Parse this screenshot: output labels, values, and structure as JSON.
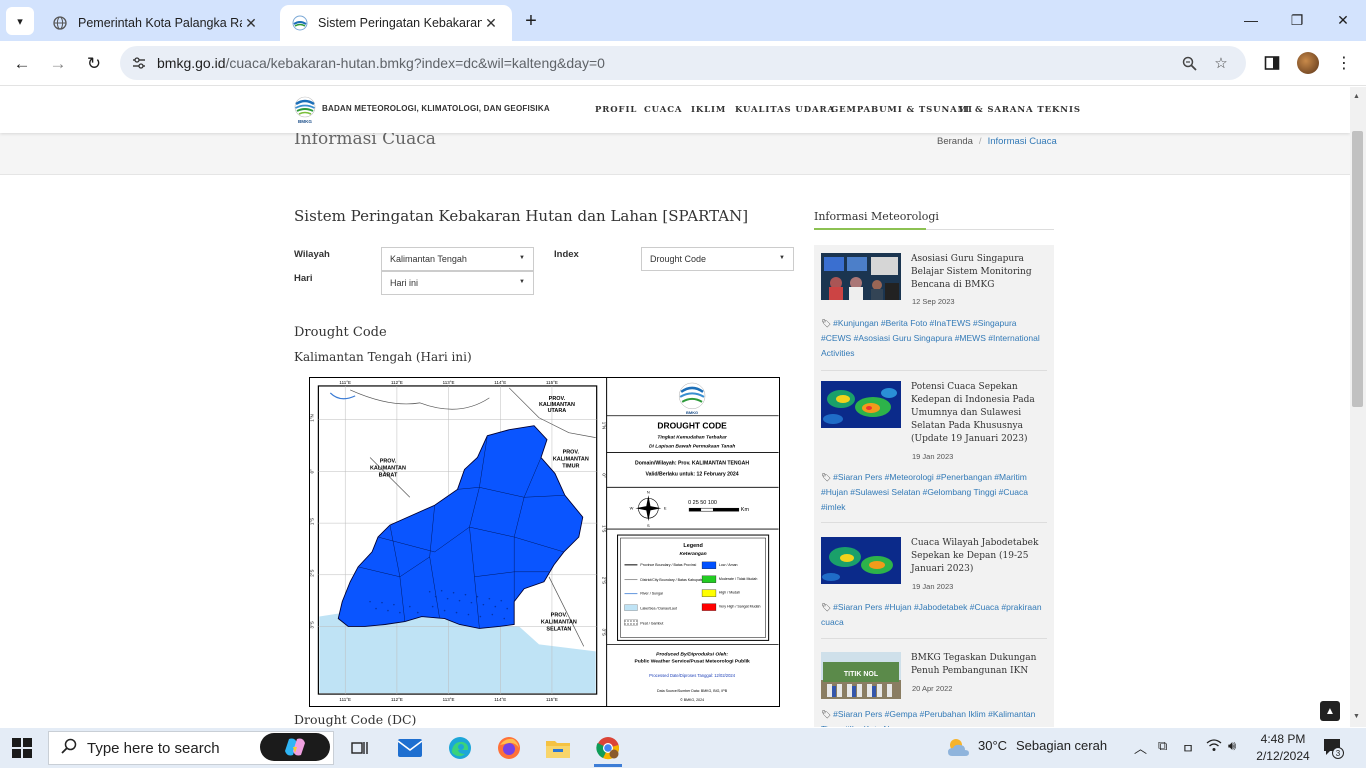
{
  "browser": {
    "tabs": [
      {
        "title": "Pemerintah Kota Palangka Raya",
        "active": false
      },
      {
        "title": "Sistem Peringatan Kebakaran H",
        "active": true
      }
    ],
    "url_host": "bmkg.go.id",
    "url_rest": "/cuaca/kebakaran-hutan.bmkg?index=dc&wil=kalteng&day=0",
    "icons": {
      "tab_dropdown": "chevron-down-icon",
      "new_tab": "plus-icon",
      "minimize": "minimize-icon",
      "restore": "restore-icon",
      "close": "close-icon",
      "back": "arrow-left-icon",
      "forward": "arrow-right-icon",
      "reload": "reload-icon",
      "site_info": "tune-icon",
      "zoom": "zoom-icon",
      "bookmark": "star-icon",
      "side_panel": "side-panel-icon",
      "menu": "kebab-menu-icon"
    }
  },
  "site": {
    "org_name": "BADAN METEOROLOGI, KLIMATOLOGI, DAN GEOFISIKA",
    "logo_text": "BMKG",
    "nav": [
      "PROFIL",
      "CUACA",
      "IKLIM",
      "KUALITAS UDARA",
      "GEMPABUMI & TSUNAMI",
      "IT & SARANA TEKNIS"
    ],
    "page_title": "Informasi Cuaca",
    "breadcrumb": {
      "home": "Beranda",
      "separator": "/",
      "current": "Informasi Cuaca"
    }
  },
  "main": {
    "section_title": "Sistem Peringatan Kebakaran Hutan dan Lahan [SPARTAN]",
    "form": {
      "wilayah_label": "Wilayah",
      "wilayah_value": "Kalimantan Tengah",
      "hari_label": "Hari",
      "hari_value": "Hari ini",
      "index_label": "Index",
      "index_value": "Drought Code"
    },
    "heading": "Drought Code",
    "subheading": "Kalimantan Tengah (Hari ini)",
    "map": {
      "title": "DROUGHT CODE",
      "subtitle1": "Tingkat Kemudahan Terbakar",
      "subtitle2": "Di Lapisan Bawah Permukaan Tanah",
      "domain": "Domain/Wilayah: Prov. KALIMANTAN TENGAH",
      "valid": "Valid/Berlaku untuk: 12 February 2024",
      "scale_text": "0  25 50     100",
      "scale_unit": "Km",
      "legend_title": "Legend",
      "legend_subtitle": "Keterangan",
      "legend_left": [
        "Province Boundary / Batas Provinsi",
        "District/City Boundary / Batas Kabupaten/Kota",
        "River / Sungai",
        "Lake/Sea / Danau/Laut",
        "Peat / Gambut"
      ],
      "legend_right": [
        {
          "label": "Low / Aman",
          "color": "#0050ff"
        },
        {
          "label": "Moderate / Tidak Mudah",
          "color": "#22cc22"
        },
        {
          "label": "High / Mudah",
          "color": "#ffff00"
        },
        {
          "label": "Very High / Sangat Mudah",
          "color": "#ff0000"
        }
      ],
      "produced_by": "Produced By/Diproduksi Oleh:",
      "producer": "Public Weather Service/Pusat Meteorologi Publik",
      "processed": "Processed Date/Diproses Tanggal: 12/02/2024",
      "datasource": "Data Source/Sumber Data: BMKG, BIG, IPB",
      "copyright": "© BMKG, 2024",
      "lon_labels": [
        "111°E",
        "112°E",
        "113°E",
        "114°E",
        "115°E"
      ],
      "lat_labels": [
        "1°N",
        "0°",
        "1°S",
        "2°S",
        "3°S"
      ],
      "province_labels": [
        "PROV. KALIMANTAN BARAT",
        "PROV. KALIMANTAN TIMUR",
        "PROV. KALIMANTAN SELATAN",
        "PROV. KALIMANTAN UTARA"
      ]
    },
    "caption": "Drought Code (DC)"
  },
  "sidebar": {
    "title": "Informasi Meteorologi",
    "items": [
      {
        "title": "Asosiasi Guru Singapura Belajar Sistem Monitoring Bencana di BMKG",
        "date": "12 Sep 2023",
        "tags": "#Kunjungan #Berita Foto #InaTEWS #Singapura #CEWS #Asosiasi Guru Singapura #MEWS #International Activities"
      },
      {
        "title": "Potensi Cuaca Sepekan Kedepan di Indonesia Pada Umumnya dan Sulawesi Selatan Pada Khususnya (Update 19 Januari 2023)",
        "date": "19 Jan 2023",
        "tags": "#Siaran Pers #Meteorologi #Penerbangan #Maritim #Hujan #Sulawesi Selatan #Gelombang Tinggi #Cuaca #imlek"
      },
      {
        "title": "Cuaca Wilayah Jabodetabek Sepekan ke Depan (19-25 Januari 2023)",
        "date": "19 Jan 2023",
        "tags": "#Siaran Pers #Hujan #Jabodetabek #Cuaca #prakiraan cuaca"
      },
      {
        "title": "BMKG Tegaskan Dukungan Penuh Pembangunan IKN",
        "date": "20 Apr 2022",
        "tags": "#Siaran Pers #Gempa #Perubahan Iklim #Kalimantan Timur #Ibu Kota Negara"
      }
    ],
    "thumb_caption": "TITIK NOL"
  },
  "taskbar": {
    "search_placeholder": "Type here to search",
    "weather_temp": "30°C",
    "weather_text": "Sebagian cerah",
    "time": "4:48 PM",
    "date": "2/12/2024",
    "notification_count": "3"
  }
}
